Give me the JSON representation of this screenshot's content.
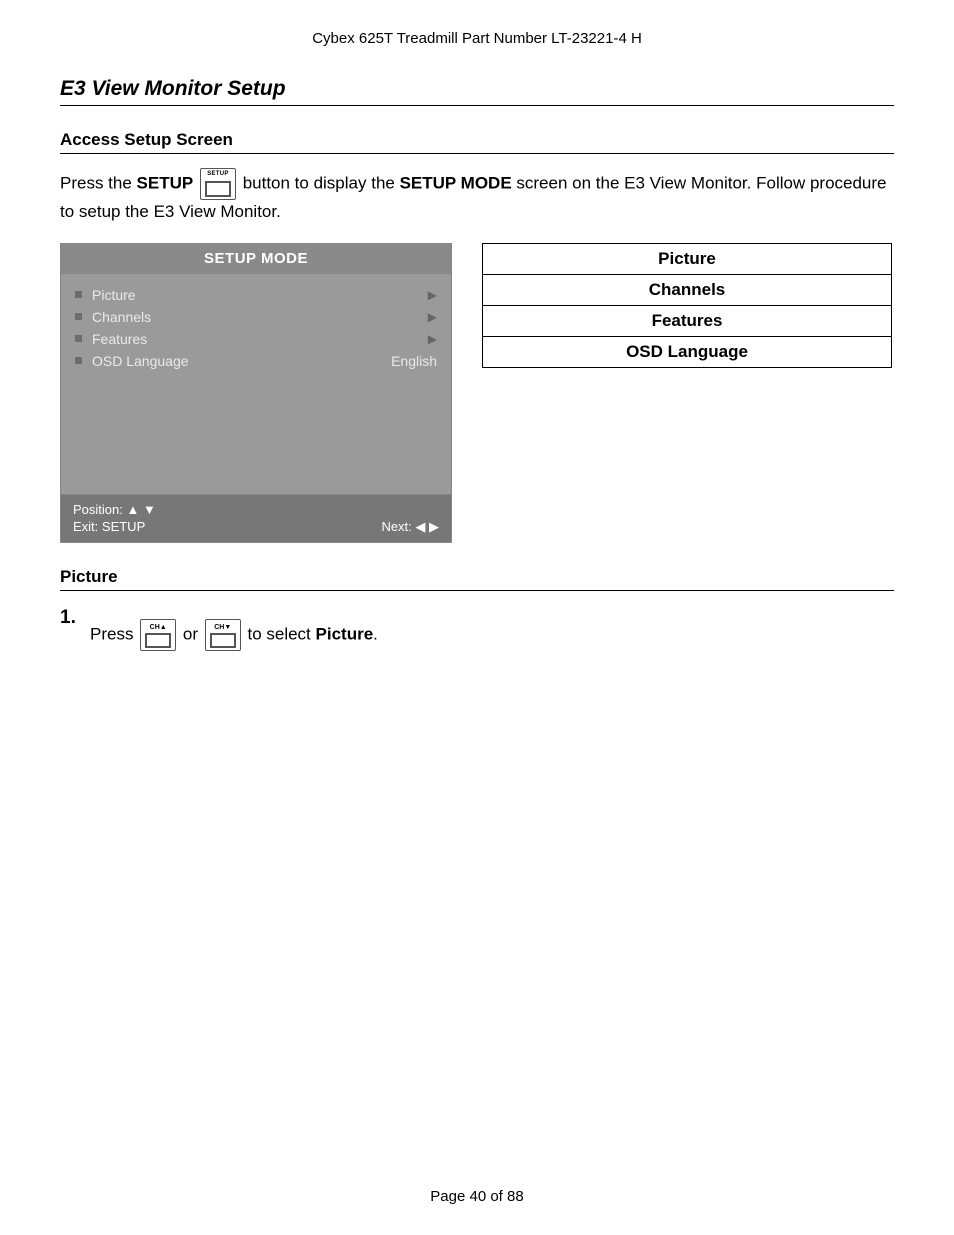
{
  "header": "Cybex 625T Treadmill Part Number LT-23221-4 H",
  "section_title": "E3 View Monitor Setup",
  "access": {
    "heading": "Access Setup Screen",
    "p1a": "Press the ",
    "p1_setup_word": "SETUP",
    "p1b": " button to display the ",
    "p1_mode_word": "SETUP MODE",
    "p1c": " screen on the E3 View Monitor. Follow procedure to setup the E3 View Monitor."
  },
  "osd": {
    "title": "SETUP MODE",
    "items": [
      {
        "label": "Picture",
        "value": "",
        "arrow": true
      },
      {
        "label": "Channels",
        "value": "",
        "arrow": true
      },
      {
        "label": "Features",
        "value": "",
        "arrow": true
      },
      {
        "label": "OSD Language",
        "value": "English",
        "arrow": false
      }
    ],
    "footer_position": "Position: ▲ ▼",
    "footer_exit": "Exit: SETUP",
    "footer_next": "Next: ◀ ▶"
  },
  "side_table": [
    "Picture",
    "Channels",
    "Features",
    "OSD Language"
  ],
  "picture": {
    "heading": "Picture",
    "step1_num": "1.",
    "step1_a": "Press ",
    "step1_or": " or ",
    "step1_b": " to select ",
    "step1_bold": "Picture",
    "step1_c": "."
  },
  "icons": {
    "setup_label": "SETUP",
    "ch_up": "CH▲",
    "ch_down": "CH▼"
  },
  "page_number": "Page 40 of 88"
}
